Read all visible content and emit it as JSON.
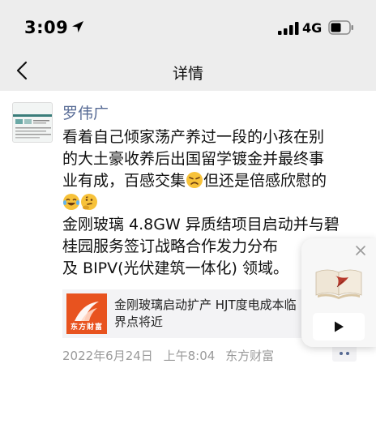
{
  "status_bar": {
    "time": "3:09",
    "network": "4G",
    "icons": [
      "location-arrow-icon",
      "signal-bars-icon",
      "battery-icon"
    ]
  },
  "nav": {
    "title": "详情",
    "back_icon": "chevron-left-icon"
  },
  "post": {
    "author": "罗伟广",
    "text_lines": [
      "看着自己倾家荡产养过一段的小孩在别",
      "的大土豪收养后出国留学镀金并最终事",
      "业有成，百感交集",
      "但还是倍感欣慰的",
      "金刚玻璃 4.8GW 异质结项目启动并与碧",
      "桂园服务签订战略合作发力分布",
      "及 BIPV(光伏建筑一体化) 领域。"
    ],
    "emojis": [
      "frowning-face-emoji",
      "crying-laughing-emoji",
      "thinking-face-emoji"
    ],
    "link_card": {
      "thumb_label": "东方财富",
      "title": "金刚玻璃启动扩产 HJT度电成本临界点将近"
    },
    "meta": {
      "date": "2022年6月24日",
      "time": "上午8:04",
      "source": "东方财富"
    }
  },
  "float_player": {
    "close_icon": "close-icon",
    "image": "open-book-with-leaf",
    "play_icon": "play-icon"
  },
  "colors": {
    "bar_background": "#ededed",
    "author_link": "#576b95",
    "meta_gray": "#9a9a9a",
    "card_background": "#f3f3f5",
    "brand_orange": "#e8531f"
  }
}
